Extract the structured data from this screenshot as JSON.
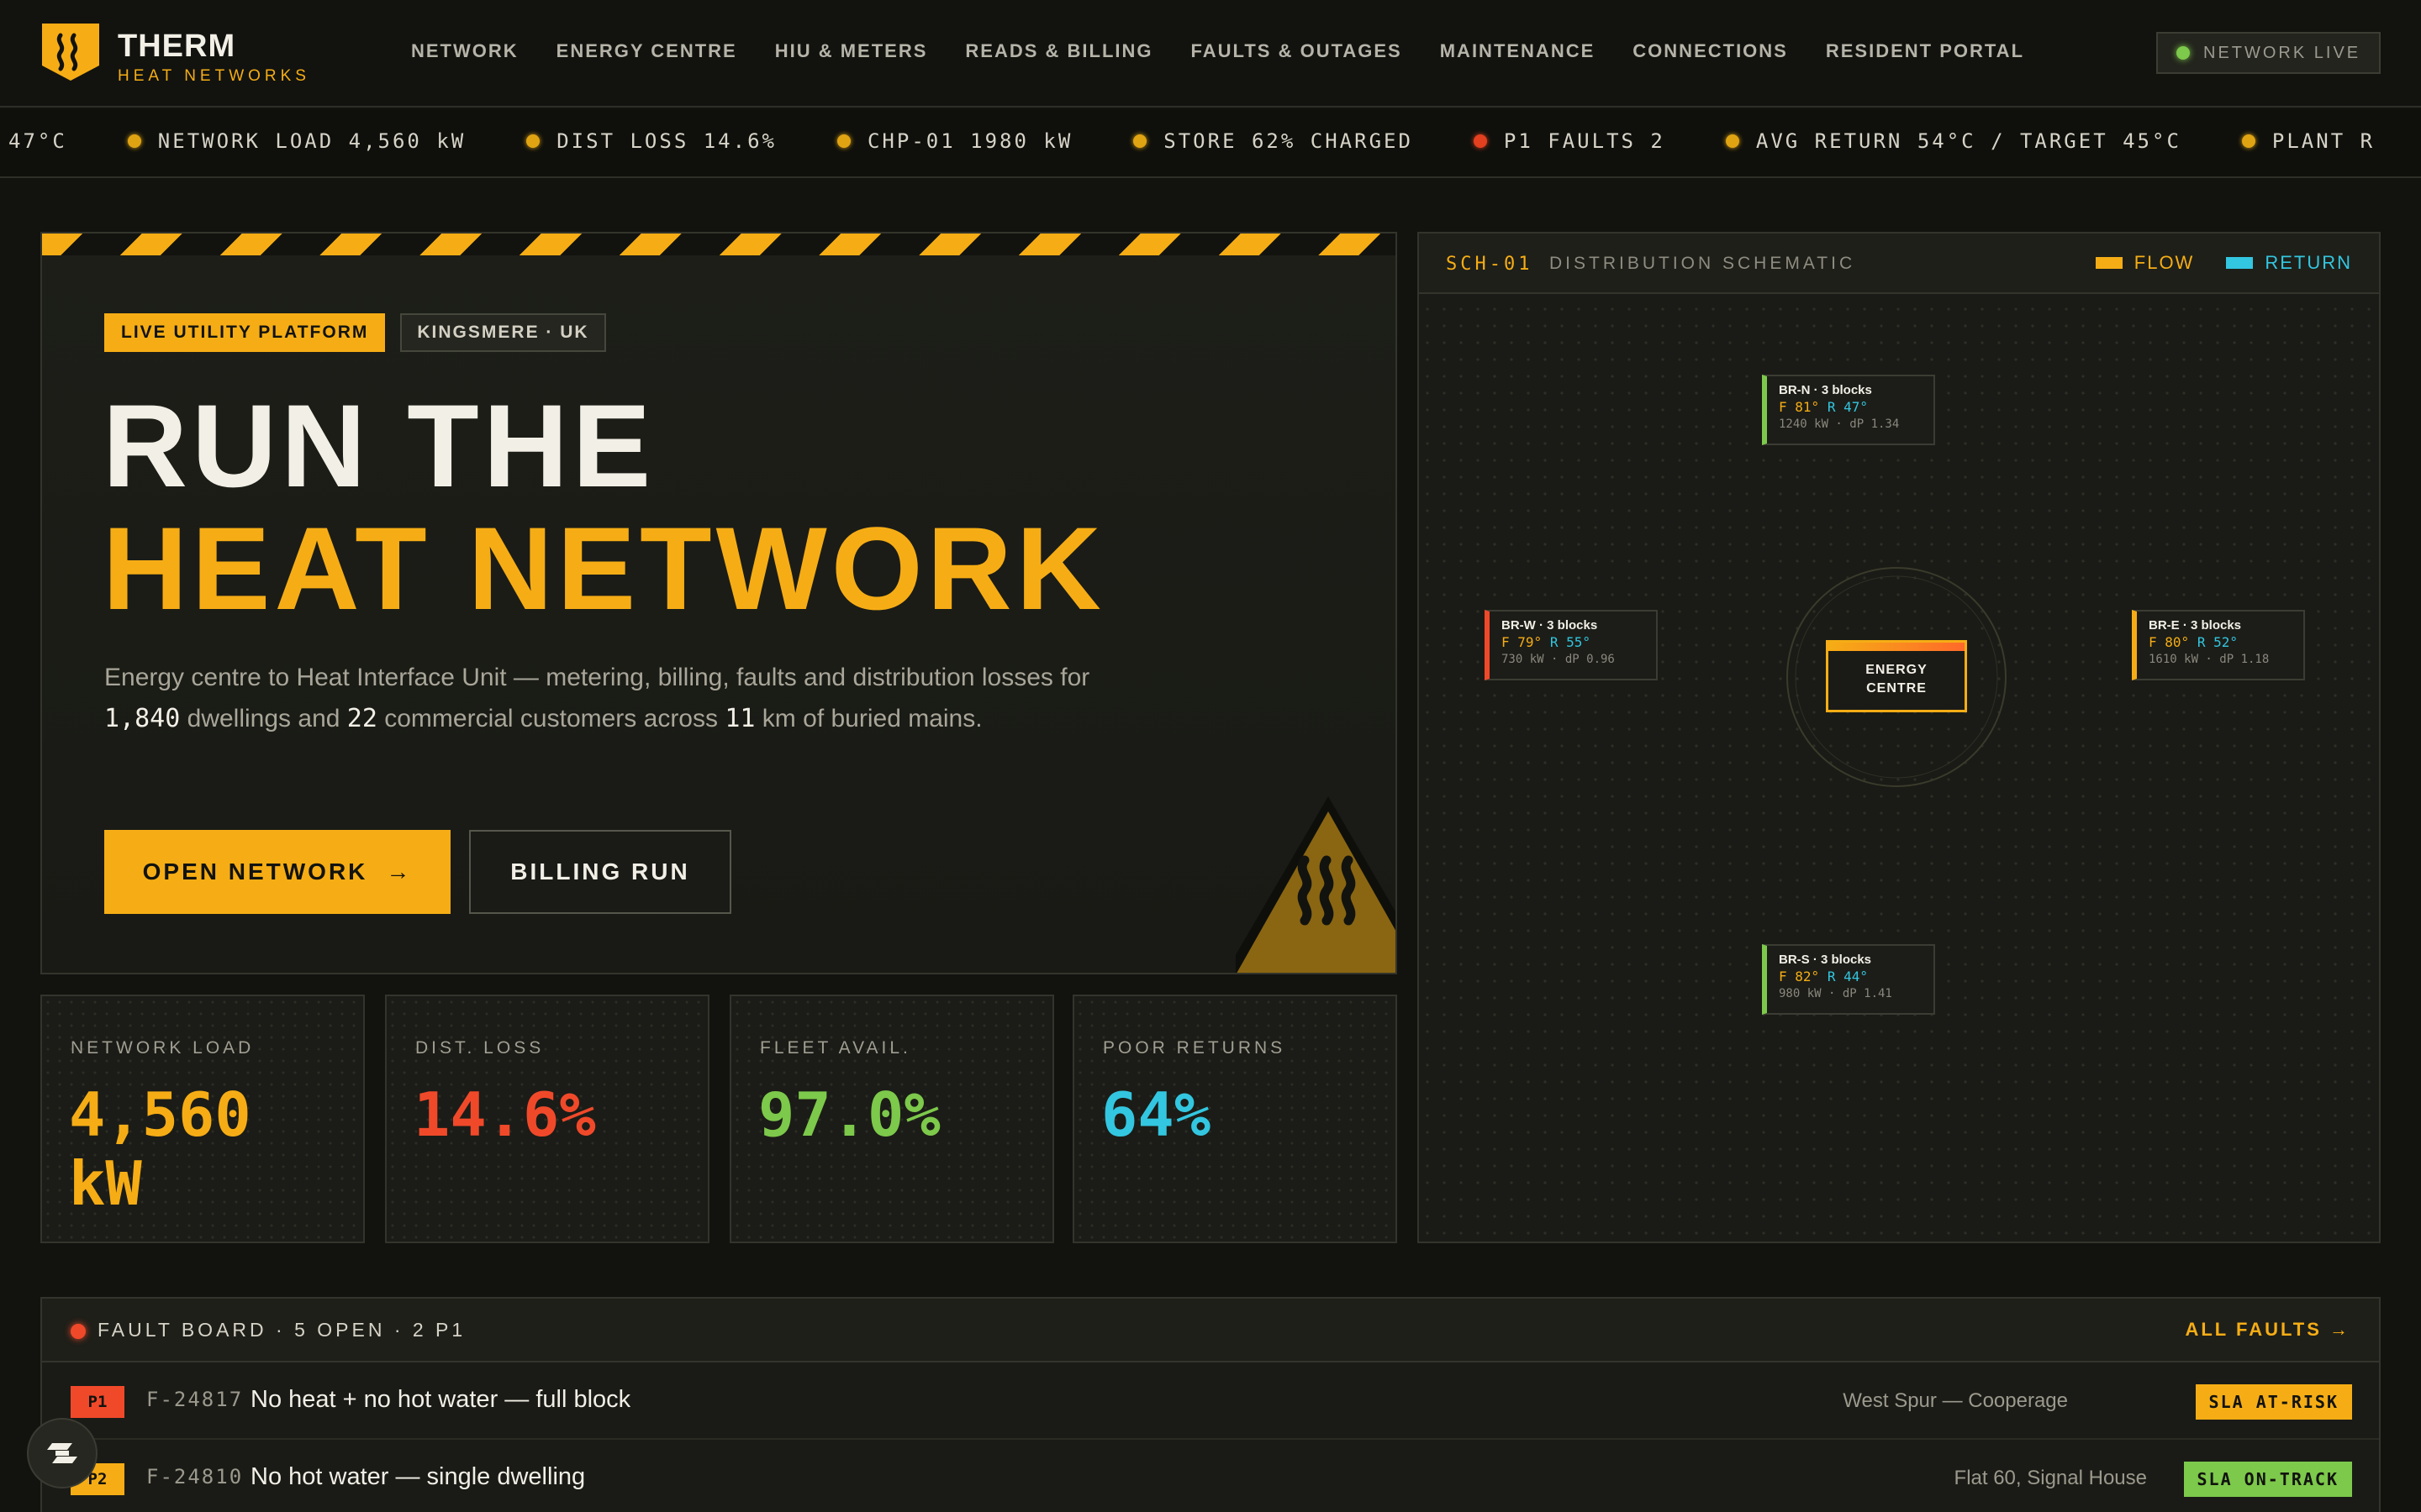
{
  "brand": {
    "name": "THERM",
    "tagline": "HEAT NETWORKS"
  },
  "nav": {
    "links": [
      "NETWORK",
      "ENERGY CENTRE",
      "HIU & METERS",
      "READS & BILLING",
      "FAULTS & OUTAGES",
      "MAINTENANCE",
      "CONNECTIONS",
      "RESIDENT PORTAL"
    ],
    "status": "NETWORK LIVE"
  },
  "ticker": {
    "lead": "47°C",
    "items": [
      {
        "text": "NETWORK LOAD 4,560 kW",
        "status": "amber"
      },
      {
        "text": "DIST LOSS 14.6%",
        "status": "amber"
      },
      {
        "text": "CHP-01 1980 kW",
        "status": "amber"
      },
      {
        "text": "STORE 62% CHARGED",
        "status": "amber"
      },
      {
        "text": "P1 FAULTS 2",
        "status": "red"
      },
      {
        "text": "AVG RETURN 54°C / TARGET 45°C",
        "status": "amber"
      },
      {
        "text": "PLANT R",
        "status": "amber"
      }
    ]
  },
  "hero": {
    "badge_primary": "LIVE UTILITY PLATFORM",
    "badge_secondary": "KINGSMERE · UK",
    "title_line1": "RUN THE",
    "title_line2": "HEAT NETWORK",
    "desc_a": "Energy centre to Heat Interface Unit — metering, billing, faults and distribution losses for ",
    "desc_dwellings": "1,840",
    "desc_b": " dwellings and ",
    "desc_commercial": "22",
    "desc_c": " commercial customers across ",
    "desc_km": "11",
    "desc_d": " km of buried mains.",
    "cta_primary": "OPEN NETWORK",
    "cta_primary_arrow": "→",
    "cta_secondary": "BILLING RUN"
  },
  "stats": [
    {
      "label": "NETWORK LOAD",
      "value": "4,560",
      "unit": "kW",
      "color": "#f6ad15"
    },
    {
      "label": "DIST. LOSS",
      "value": "14.6%",
      "unit": "",
      "color": "#f0492a"
    },
    {
      "label": "FLEET AVAIL.",
      "value": "97.0%",
      "unit": "",
      "color": "#7dc94b"
    },
    {
      "label": "POOR RETURNS",
      "value": "64%",
      "unit": "",
      "color": "#33c6e0"
    }
  ],
  "schematic": {
    "code": "SCH-01",
    "title": "DISTRIBUTION SCHEMATIC",
    "legend_flow": "FLOW",
    "legend_return": "RETURN",
    "energy_centre_line1": "ENERGY",
    "energy_centre_line2": "CENTRE",
    "branches": {
      "north": {
        "title": "BR-N · 3 blocks",
        "flow": "F 81°",
        "ret": "R 47°",
        "meta": "1240 kW · dP 1.34",
        "color": "#7dc94b"
      },
      "west": {
        "title": "BR-W · 3 blocks",
        "flow": "F 79°",
        "ret": "R 55°",
        "meta": "730 kW · dP 0.96",
        "color": "#f0492a"
      },
      "east": {
        "title": "BR-E · 3 blocks",
        "flow": "F 80°",
        "ret": "R 52°",
        "meta": "1610 kW · dP 1.18",
        "color": "#f6ad15"
      },
      "south": {
        "title": "BR-S · 3 blocks",
        "flow": "F 82°",
        "ret": "R 44°",
        "meta": "980 kW · dP 1.41",
        "color": "#7dc94b"
      }
    },
    "colors": {
      "flow": "#f6ad15",
      "return": "#33c6e0"
    }
  },
  "faults": {
    "title": "FAULT BOARD · 5 OPEN · 2 P1",
    "all_link": "ALL FAULTS →",
    "rows": [
      {
        "priority": "P1",
        "id": "F-24817",
        "desc": "No heat + no hot water — full block",
        "location": "West Spur — Cooperage",
        "sla": "SLA AT-RISK",
        "prio_color": "#f0492a",
        "sla_color": "#f6ad15"
      },
      {
        "priority": "P2",
        "id": "F-24810",
        "desc": "No hot water — single dwelling",
        "location": "Flat 60, Signal House",
        "sla": "SLA ON-TRACK",
        "prio_color": "#f6ad15",
        "sla_color": "#7dc94b"
      }
    ]
  }
}
